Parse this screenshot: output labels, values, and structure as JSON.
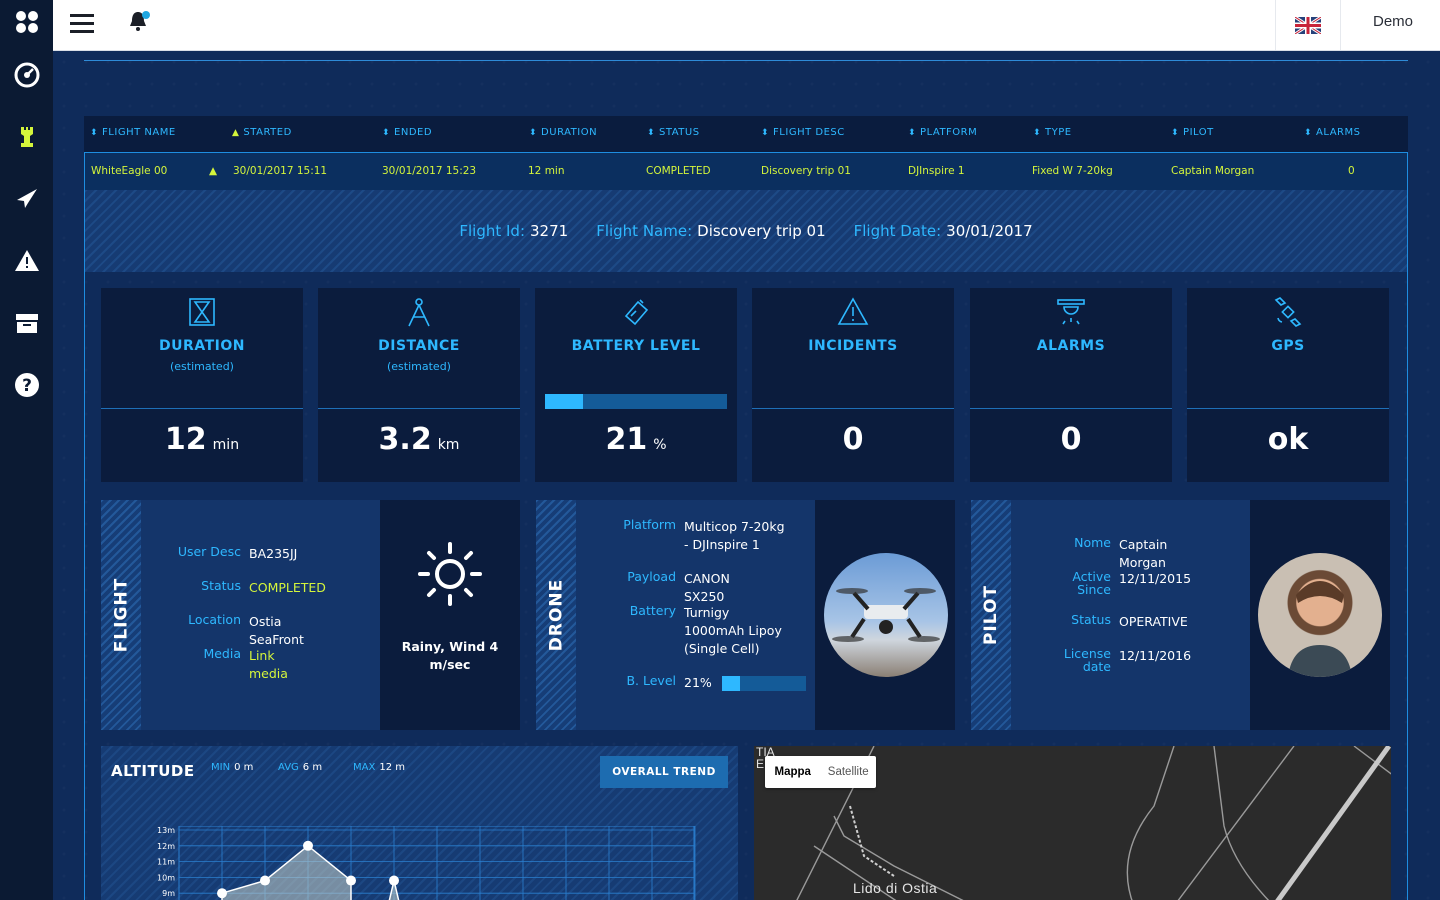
{
  "sidebar": {
    "items": [
      {
        "icon": "logo-icon"
      },
      {
        "icon": "dashboard-gauge-icon"
      },
      {
        "icon": "chess-rook-icon",
        "active": true
      },
      {
        "icon": "paper-plane-icon"
      },
      {
        "icon": "warning-icon"
      },
      {
        "icon": "archive-icon"
      },
      {
        "icon": "help-icon"
      }
    ]
  },
  "topbar": {
    "language_flag": "uk-flag-icon",
    "user": "Demo"
  },
  "table": {
    "headers": [
      "FLIGHT NAME",
      "STARTED",
      "ENDED",
      "DURATION",
      "STATUS",
      "FLIGHT DESC",
      "PLATFORM",
      "TYPE",
      "PILOT",
      "ALARMS"
    ],
    "row": [
      "WhiteEagle 00",
      "30/01/2017 15:11",
      "30/01/2017 15:23",
      "12 min",
      "COMPLETED",
      "Discovery trip 01",
      "DJInspire 1",
      "Fixed W 7-20kg",
      "Captain Morgan",
      "0"
    ]
  },
  "summary": {
    "flight_id_label": "Flight Id:",
    "flight_id": "3271",
    "flight_name_label": "Flight Name:",
    "flight_name": "Discovery trip 01",
    "flight_date_label": "Flight Date:",
    "flight_date": "30/01/2017"
  },
  "kpis": [
    {
      "title": "DURATION",
      "sub": "(estimated)",
      "value": "12",
      "unit": "min",
      "icon": "hourglass-icon"
    },
    {
      "title": "DISTANCE",
      "sub": "(estimated)",
      "value": "3.2",
      "unit": "km",
      "icon": "compass-icon"
    },
    {
      "title": "BATTERY LEVEL",
      "sub": "",
      "value": "21",
      "unit": "%",
      "icon": "battery-icon",
      "level": 0.21
    },
    {
      "title": "INCIDENTS",
      "sub": "",
      "value": "0",
      "unit": "",
      "icon": "warning-triangle-icon"
    },
    {
      "title": "ALARMS",
      "sub": "",
      "value": "0",
      "unit": "",
      "icon": "alarm-light-icon"
    },
    {
      "title": "GPS",
      "sub": "",
      "value": "ok",
      "unit": "",
      "icon": "satellite-icon"
    }
  ],
  "flight_card": {
    "label": "FLIGHT",
    "user_desc_label": "User Desc",
    "user_desc": "BA235JJ",
    "status_label": "Status",
    "status": "COMPLETED",
    "location_label": "Location",
    "location": "Ostia SeaFront",
    "media_label": "Media",
    "media": "Link media",
    "weather": "Rainy, Wind 4 m/sec"
  },
  "drone_card": {
    "label": "DRONE",
    "platform_label": "Platform",
    "platform_1": "Multicop 7-20kg",
    "platform_2": "- DJInspire 1",
    "payload_label": "Payload",
    "payload": "CANON SX250",
    "battery_label": "Battery",
    "battery_1": "Turnigy",
    "battery_2": "1000mAh Lipoy",
    "battery_3": "(Single Cell)",
    "blevel_label": "B. Level",
    "blevel": "21%",
    "blevel_value": 0.21
  },
  "pilot_card": {
    "label": "PILOT",
    "name_label": "Nome",
    "name": "Captain Morgan",
    "active_label_1": "Active",
    "active_label_2": "Since",
    "active": "12/11/2015",
    "status_label": "Status",
    "status": "OPERATIVE",
    "license_label_1": "License",
    "license_label_2": "date",
    "license": "12/11/2016"
  },
  "altitude": {
    "title": "ALTITUDE",
    "min_label": "MIN",
    "min": "0 m",
    "avg_label": "AVG",
    "avg": "6 m",
    "max_label": "MAX",
    "max": "12 m",
    "trend_button": "OVERALL TREND"
  },
  "chart_data": {
    "type": "area",
    "title": "ALTITUDE",
    "y_ticks": [
      "13m",
      "12m",
      "11m",
      "10m",
      "9m"
    ],
    "ylim": [
      9,
      13
    ],
    "points": [
      {
        "x": 0,
        "y": 9
      },
      {
        "x": 1,
        "y": 9.8
      },
      {
        "x": 2,
        "y": 12
      },
      {
        "x": 3,
        "y": 9.8
      },
      {
        "x": 4,
        "y": 9.8
      }
    ],
    "grid": true
  },
  "map": {
    "tab_map": "Mappa",
    "tab_satellite": "Satellite",
    "place": "Lido di Ostia",
    "corner_label_1": "TIA",
    "corner_label_2": "E"
  },
  "colors": {
    "accent_blue": "#2eb8ff",
    "accent_lime": "#d4f53b",
    "panel_dark": "#0b1c3d"
  }
}
